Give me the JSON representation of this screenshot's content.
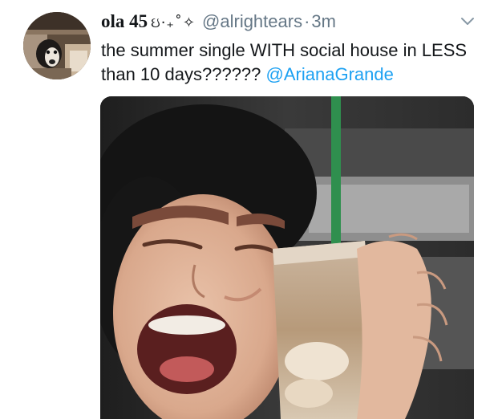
{
  "tweet": {
    "display_name": "ola 45",
    "name_decoration": "ઇ·₊˚✧",
    "handle": "@alrightears",
    "separator": "·",
    "time": "3m",
    "text_before": "the summer single WITH social house in LESS than 10 days??????",
    "mention": "@ArianaGrande"
  },
  "icons": {
    "caret": "chevron-down-icon"
  },
  "colors": {
    "link": "#1da1f2",
    "muted": "#657786",
    "text": "#14171a"
  }
}
